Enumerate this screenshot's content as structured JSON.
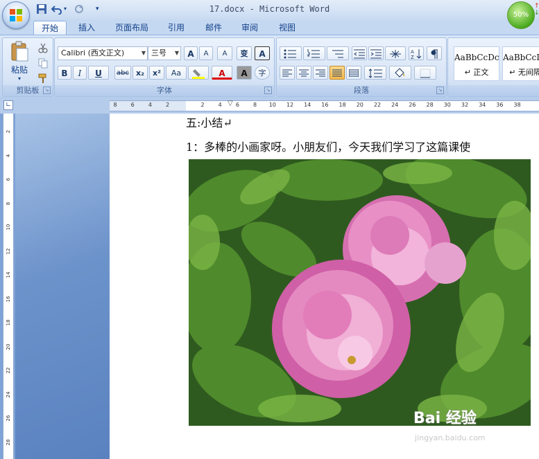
{
  "window": {
    "title": "17.docx - Microsoft Word",
    "network_widget": "50%"
  },
  "tabs": [
    "开始",
    "插入",
    "页面布局",
    "引用",
    "邮件",
    "审阅",
    "视图"
  ],
  "ribbon": {
    "clipboard": {
      "label": "剪贴板",
      "paste_label": "粘贴"
    },
    "font": {
      "label": "字体",
      "font_name": "Calibri (西文正文)",
      "font_size": "三号",
      "bold": "B",
      "italic": "I",
      "underline": "U",
      "strikethrough": "abc",
      "subscript": "x₂",
      "superscript": "x²",
      "change_case": "Aa",
      "font_color_letter": "A",
      "char_shading_letter": "A",
      "grow": "A",
      "shrink": "A",
      "clear_format": "A",
      "phonetic": "变",
      "char_border": "A",
      "enclose": "字"
    },
    "paragraph": {
      "label": "段落"
    },
    "styles": {
      "items": [
        {
          "sample": "AaBbCcDc",
          "name": "↵ 正文"
        },
        {
          "sample": "AaBbCcDc",
          "name": "↵ 无间隔"
        }
      ]
    }
  },
  "ruler": {
    "horizontal_ticks": [
      "8",
      "6",
      "4",
      "2",
      "",
      "2",
      "4",
      "6",
      "8",
      "10",
      "12",
      "14",
      "16",
      "18",
      "20",
      "22",
      "24",
      "26",
      "28",
      "30",
      "32",
      "34",
      "36",
      "38"
    ],
    "vertical_ticks": [
      "2",
      "4",
      "6",
      "8",
      "10",
      "12",
      "14",
      "16",
      "18",
      "20",
      "22",
      "24",
      "26",
      "28"
    ]
  },
  "document": {
    "heading": "五:小结↵",
    "paragraph": "1：多棒的小画家呀。小朋友们，今天我们学习了这篇课使"
  },
  "watermark": {
    "brand": "Bai 经验",
    "url": "jingyan.baidu.com"
  }
}
